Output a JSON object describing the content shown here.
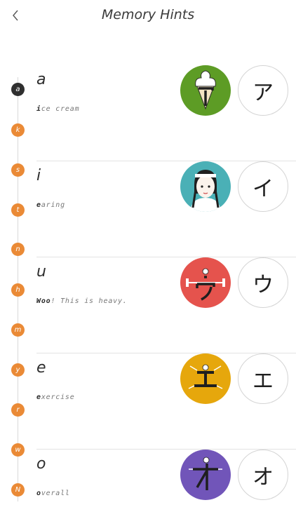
{
  "header": {
    "title": "Memory Hints",
    "back_icon": "chevron-left-icon"
  },
  "rail": {
    "items": [
      "a",
      "k",
      "s",
      "t",
      "n",
      "h",
      "m",
      "y",
      "r",
      "w",
      "N"
    ],
    "active": "a"
  },
  "hints": [
    {
      "romaji": "a",
      "hint_first": "i",
      "hint_rest": "ce cream",
      "kana": "ア",
      "picture": "ice-cream",
      "color": "#5d9c25"
    },
    {
      "romaji": "i",
      "hint_first": "e",
      "hint_rest": "aring",
      "kana": "イ",
      "picture": "girl-earring",
      "color": "#4ab0b6"
    },
    {
      "romaji": "u",
      "hint_first": "Woo",
      "hint_rest": "! This is heavy.",
      "kana": "ウ",
      "picture": "weightlifter",
      "color": "#e5534d"
    },
    {
      "romaji": "e",
      "hint_first": "e",
      "hint_rest": "xercise",
      "kana": "エ",
      "picture": "exercise",
      "color": "#e6a70c"
    },
    {
      "romaji": "o",
      "hint_first": "o",
      "hint_rest": "verall",
      "kana": "オ",
      "picture": "overall",
      "color": "#7155b9"
    }
  ],
  "colors": {
    "accent": "#ea8a36",
    "active_dot": "#2f2f2f",
    "divider": "#e3e3e3"
  }
}
